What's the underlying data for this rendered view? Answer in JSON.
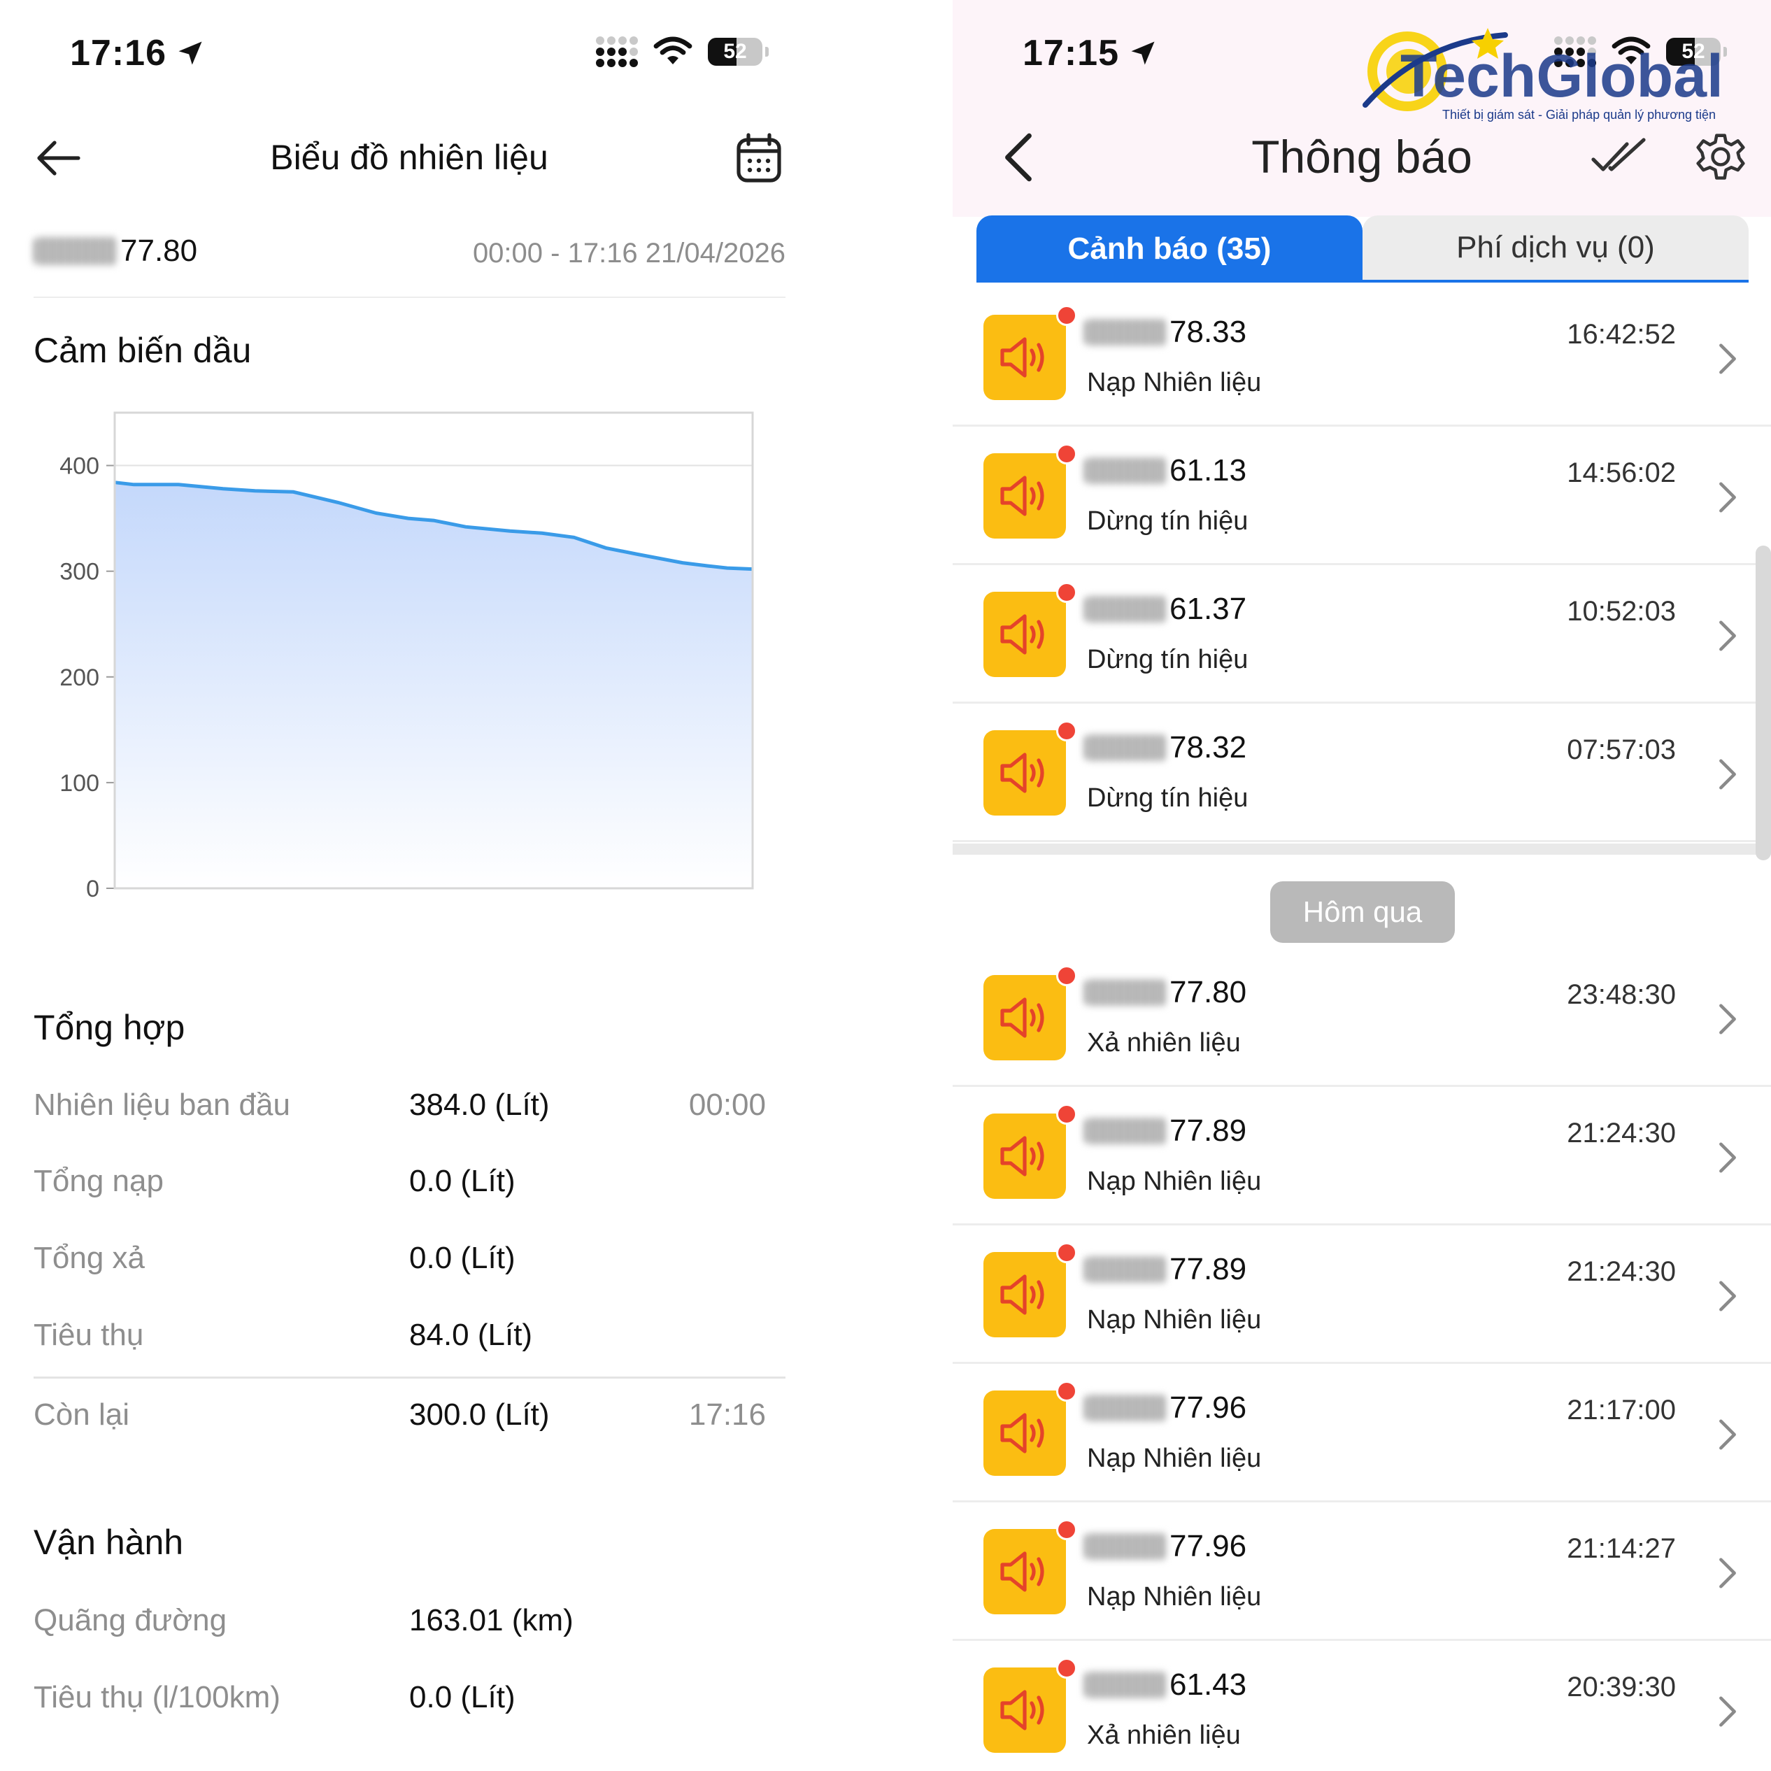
{
  "left": {
    "status": {
      "time": "17:16",
      "battery": "52"
    },
    "title": "Biểu đồ nhiên liệu",
    "vehicle_suffix": "77.80",
    "time_range": "00:00 - 17:16 21/04/2026",
    "sensor_section": "Cảm biến dầu",
    "summary_section": "Tổng hợp",
    "summary": [
      {
        "label": "Nhiên liệu ban đầu",
        "value": "384.0 (Lít)",
        "time": "00:00"
      },
      {
        "label": "Tổng nạp",
        "value": "0.0 (Lít)",
        "time": ""
      },
      {
        "label": "Tổng xả",
        "value": "0.0 (Lít)",
        "time": ""
      },
      {
        "label": "Tiêu thụ",
        "value": "84.0 (Lít)",
        "time": ""
      },
      {
        "label": "Còn lại",
        "value": "300.0 (Lít)",
        "time": "17:16"
      }
    ],
    "operation_section": "Vận hành",
    "operation": [
      {
        "label": "Quãng đường",
        "value": "163.01 (km)"
      },
      {
        "label": "Tiêu thụ (l/100km)",
        "value": "0.0 (Lít)"
      }
    ]
  },
  "chart_data": {
    "type": "area",
    "title": "",
    "xlabel": "",
    "ylabel": "",
    "ylim": [
      0,
      450
    ],
    "yticks": [
      0,
      100,
      200,
      300,
      400
    ],
    "grid": true,
    "x": [
      0,
      0.03,
      0.1,
      0.17,
      0.22,
      0.28,
      0.35,
      0.41,
      0.46,
      0.5,
      0.55,
      0.62,
      0.67,
      0.72,
      0.77,
      0.82,
      0.89,
      0.93,
      0.96,
      1.0
    ],
    "values": [
      384,
      382,
      382,
      378,
      376,
      375,
      365,
      355,
      350,
      348,
      342,
      338,
      336,
      332,
      322,
      316,
      308,
      305,
      303,
      302
    ],
    "colors": {
      "line": "#3a9be8",
      "fill_top": "#c4d8fb",
      "fill_bottom": "#ffffff"
    }
  },
  "right": {
    "status": {
      "time": "17:15",
      "battery": "52"
    },
    "logo": {
      "name": "TechGlobal",
      "tagline": "Thiết bị giám sát - Giải pháp quản lý phương tiện"
    },
    "title": "Thông báo",
    "tabs": [
      {
        "label": "Cảnh báo (35)",
        "active": true
      },
      {
        "label": "Phí dịch vụ (0)",
        "active": false
      }
    ],
    "today": [
      {
        "plate": "78.33",
        "desc": "Nạp Nhiên liệu",
        "time": "16:42:52"
      },
      {
        "plate": "61.13",
        "desc": "Dừng tín hiệu",
        "time": "14:56:02"
      },
      {
        "plate": "61.37",
        "desc": "Dừng tín hiệu",
        "time": "10:52:03"
      },
      {
        "plate": "78.32",
        "desc": "Dừng tín hiệu",
        "time": "07:57:03"
      }
    ],
    "day_label": "Hôm qua",
    "yesterday": [
      {
        "plate": "77.80",
        "desc": "Xả nhiên liệu",
        "time": "23:48:30"
      },
      {
        "plate": "77.89",
        "desc": "Nạp Nhiên liệu",
        "time": "21:24:30"
      },
      {
        "plate": "77.89",
        "desc": "Nạp Nhiên liệu",
        "time": "21:24:30"
      },
      {
        "plate": "77.96",
        "desc": "Nạp Nhiên liệu",
        "time": "21:17:00"
      },
      {
        "plate": "77.96",
        "desc": "Nạp Nhiên liệu",
        "time": "21:14:27"
      },
      {
        "plate": "61.43",
        "desc": "Xả nhiên liệu",
        "time": "20:39:30"
      }
    ],
    "colors": {
      "accent": "#1a73e8",
      "alert": "#fbbd12",
      "dot": "#ef4437"
    }
  }
}
